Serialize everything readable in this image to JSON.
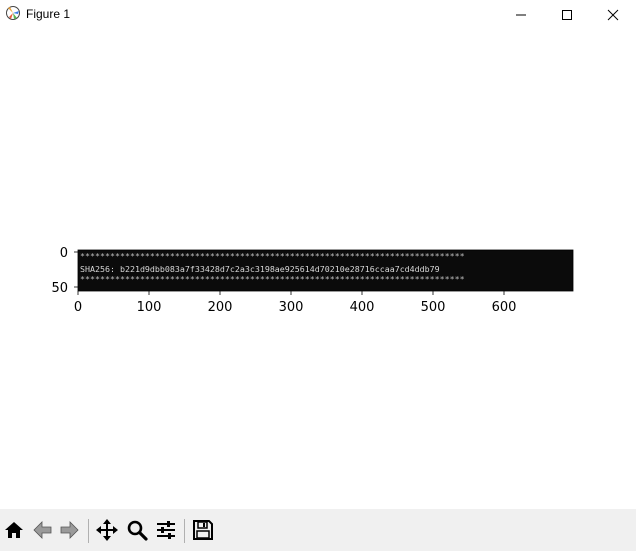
{
  "window": {
    "title": "Figure 1",
    "controls": {
      "minimize": "minimize-icon",
      "maximize": "maximize-icon",
      "close": "close-icon"
    }
  },
  "figure": {
    "image_lines": {
      "top_border": "*****************************************************************************",
      "hash_line": "SHA256:  b221d9dbb083a7f33428d7c2a3c3198ae925614d70210e28716ccaa7cd4ddb79",
      "bottom_border": "*****************************************************************************"
    },
    "y_ticks": [
      "0",
      "50"
    ],
    "x_ticks": [
      "0",
      "100",
      "200",
      "300",
      "400",
      "500",
      "600"
    ],
    "colors": {
      "image_bg": "#0b0b0b",
      "image_text": "#d8d8d8"
    }
  },
  "toolbar": {
    "buttons": [
      "home-icon",
      "back-icon",
      "forward-icon",
      "pan-icon",
      "zoom-icon",
      "configure-subplots-icon",
      "save-icon"
    ]
  }
}
